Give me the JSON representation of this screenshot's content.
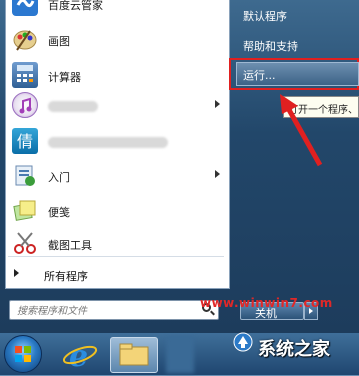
{
  "left_menu": {
    "items": [
      {
        "label": "百度云管家",
        "icon": "baidu-cloud-icon",
        "has_arrow": false
      },
      {
        "label": "画图",
        "icon": "paint-icon",
        "has_arrow": false
      },
      {
        "label": "计算器",
        "icon": "calculator-icon",
        "has_arrow": false
      },
      {
        "label": "",
        "icon": "itunes-icon",
        "has_arrow": true
      },
      {
        "label": "",
        "icon": "qq-app-icon",
        "has_arrow": false
      },
      {
        "label": "入门",
        "icon": "getting-started-icon",
        "has_arrow": true
      },
      {
        "label": "便笺",
        "icon": "sticky-notes-icon",
        "has_arrow": false
      },
      {
        "label": "截图工具",
        "icon": "snipping-tool-icon",
        "has_arrow": false
      }
    ],
    "all_programs": "所有程序",
    "search_placeholder": "搜索程序和文件"
  },
  "right_menu": {
    "default_programs": "默认程序",
    "help_support": "帮助和支持",
    "run": "运行...",
    "tooltip": "打开一个程序、",
    "shutdown": "关机"
  },
  "watermark": {
    "url": "www.winwin7.com",
    "brand": "系统之家"
  },
  "colors": {
    "highlight_box": "#e02020",
    "menu_bg": "#1d3c5c"
  }
}
